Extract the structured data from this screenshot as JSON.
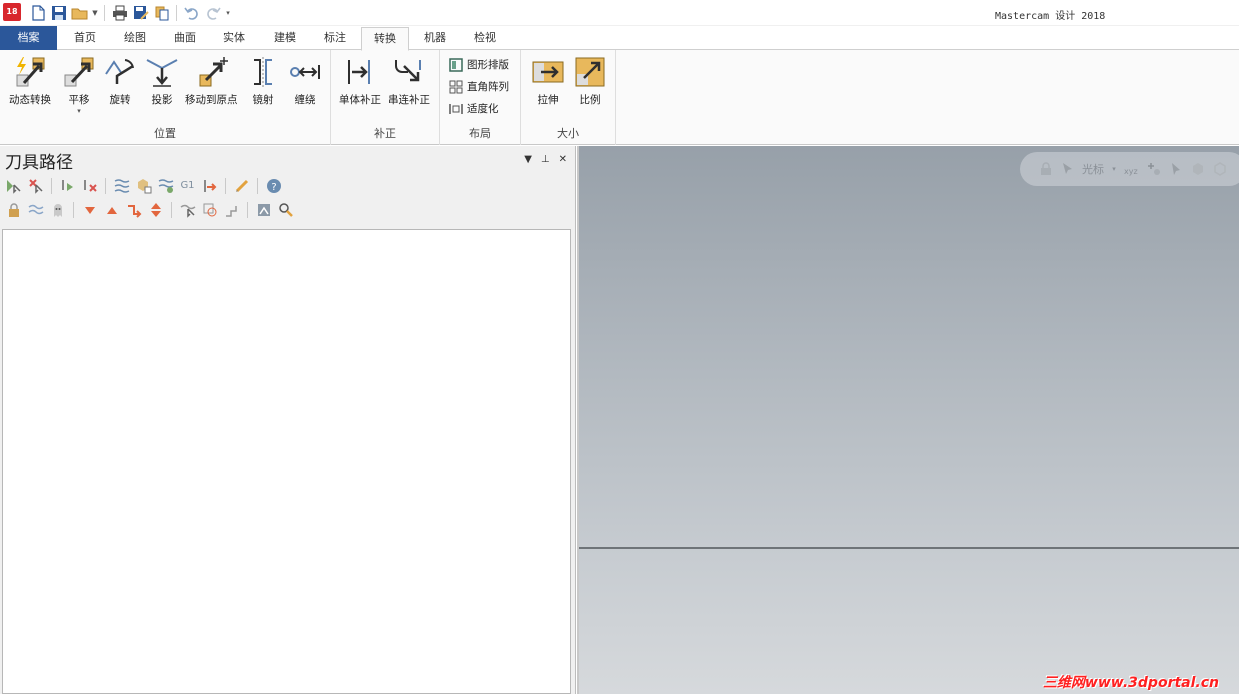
{
  "app": {
    "logo_text": "18",
    "title": "Mastercam 设计 2018"
  },
  "tabs": [
    {
      "label": "档案"
    },
    {
      "label": "首页"
    },
    {
      "label": "绘图"
    },
    {
      "label": "曲面"
    },
    {
      "label": "实体"
    },
    {
      "label": "建模"
    },
    {
      "label": "标注"
    },
    {
      "label": "转换"
    },
    {
      "label": "机器"
    },
    {
      "label": "检视"
    }
  ],
  "ribbon": {
    "position_group": {
      "label": "位置",
      "buttons": [
        "动态转换",
        "平移",
        "旋转",
        "投影",
        "移动到原点",
        "镜射",
        "缠绕"
      ]
    },
    "offset_group": {
      "label": "补正",
      "buttons": [
        "单体补正",
        "串连补正"
      ]
    },
    "layout_group": {
      "label": "布局",
      "items": [
        "图形排版",
        "直角阵列",
        "适度化"
      ]
    },
    "size_group": {
      "label": "大小",
      "buttons": [
        "拉伸",
        "比例"
      ]
    }
  },
  "panel": {
    "title": "刀具路径",
    "g1_label": "G1"
  },
  "viewport": {
    "cursor_label": "光标"
  },
  "watermark": "三维网www.3dportal.cn",
  "colors": {
    "file_tab": "#2b579a",
    "accent_icon": "#e8b85c",
    "icon_dark": "#2f2f2f",
    "watermark": "#ff2020"
  }
}
